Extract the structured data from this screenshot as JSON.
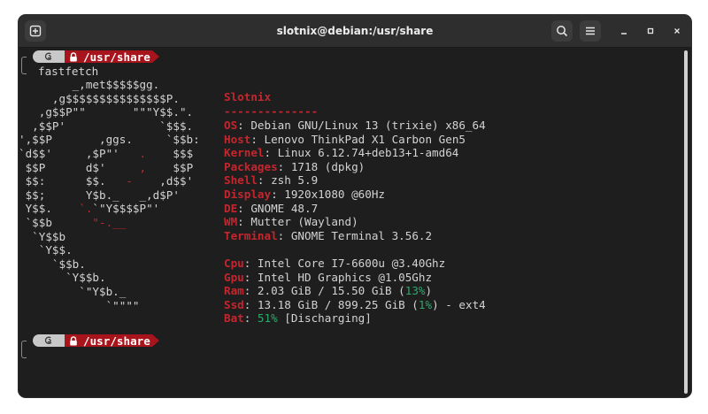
{
  "window": {
    "title": "slotnix@debian:/usr/share"
  },
  "titlebar_icons": {
    "new_tab": "new-tab-icon",
    "search": "search-icon",
    "menu": "hamburger-menu-icon",
    "minimize": "minimize-icon",
    "maximize": "maximize-icon",
    "close": "close-icon"
  },
  "prompt": {
    "os_icon": "debian-swirl-icon",
    "lock_icon": "lock-icon",
    "path": "/usr/share"
  },
  "command": "fastfetch",
  "logo": [
    {
      "seg": [
        {
          "t": "        _,met$$$$$gg.",
          "c": ""
        }
      ]
    },
    {
      "seg": [
        {
          "t": "     ,g$$$$$$$$$$$$$$$P.",
          "c": ""
        }
      ]
    },
    {
      "seg": [
        {
          "t": "   ,g$$P\"\"       \"\"\"Y$$.\".",
          "c": ""
        }
      ]
    },
    {
      "seg": [
        {
          "t": "  ,$$P'              `$$$.",
          "c": ""
        }
      ]
    },
    {
      "seg": [
        {
          "t": "',$$P       ,ggs.     `$$b:",
          "c": ""
        }
      ]
    },
    {
      "seg": [
        {
          "t": "`d$$'     ,$P\"'   ",
          "c": ""
        },
        {
          "t": ".",
          "c": "red"
        },
        {
          "t": "    $$$",
          "c": ""
        }
      ]
    },
    {
      "seg": [
        {
          "t": " $$P      d$'     ",
          "c": ""
        },
        {
          "t": ",",
          "c": "red"
        },
        {
          "t": "    $$P",
          "c": ""
        }
      ]
    },
    {
      "seg": [
        {
          "t": " $$:      $$.   ",
          "c": ""
        },
        {
          "t": "-",
          "c": "red"
        },
        {
          "t": "    ,d$$'",
          "c": ""
        }
      ]
    },
    {
      "seg": [
        {
          "t": " $$;      Y$b._   _,d$P'",
          "c": ""
        }
      ]
    },
    {
      "seg": [
        {
          "t": " Y$$.    ",
          "c": ""
        },
        {
          "t": "`.",
          "c": "red"
        },
        {
          "t": "`\"Y$$$$P\"'",
          "c": ""
        }
      ]
    },
    {
      "seg": [
        {
          "t": " `$$b      ",
          "c": ""
        },
        {
          "t": "\"-.__",
          "c": "red"
        }
      ]
    },
    {
      "seg": [
        {
          "t": "  `Y$$b",
          "c": ""
        }
      ]
    },
    {
      "seg": [
        {
          "t": "   `Y$$.",
          "c": ""
        }
      ]
    },
    {
      "seg": [
        {
          "t": "     `$$b.",
          "c": ""
        }
      ]
    },
    {
      "seg": [
        {
          "t": "       `Y$$b.",
          "c": ""
        }
      ]
    },
    {
      "seg": [
        {
          "t": "         `\"Y$b._",
          "c": ""
        }
      ]
    },
    {
      "seg": [
        {
          "t": "             `\"\"\"\"",
          "c": ""
        }
      ]
    }
  ],
  "info": {
    "user": "Slotnix",
    "separator": "--------------",
    "rows": [
      {
        "key": "OS",
        "value": "Debian GNU/Linux 13 (trixie) x86_64"
      },
      {
        "key": "Host",
        "value": "Lenovo ThinkPad X1 Carbon Gen5"
      },
      {
        "key": "Kernel",
        "value": "Linux 6.12.74+deb13+1-amd64"
      },
      {
        "key": "Packages",
        "value": "1718 (dpkg)"
      },
      {
        "key": "Shell",
        "value": "zsh 5.9"
      },
      {
        "key": "Display",
        "value": "1920x1080 @60Hz"
      },
      {
        "key": "DE",
        "value": "GNOME 48.7"
      },
      {
        "key": "WM",
        "value": "Mutter (Wayland)"
      },
      {
        "key": "Terminal",
        "value": "GNOME Terminal 3.56.2"
      }
    ],
    "hw_rows": [
      {
        "key": "Cpu",
        "value": "Intel Core I7-6600u @3.40Ghz"
      },
      {
        "key": "Gpu",
        "value": "Intel HD Graphics @1.05Ghz"
      },
      {
        "key": "Ram",
        "pre": "2.03 GiB / 15.50 GiB (",
        "pct": "13%",
        "post": ")"
      },
      {
        "key": "Ssd",
        "pre": "13.18 GiB / 899.25 GiB (",
        "pct": "1%",
        "post": ") - ext4"
      },
      {
        "key": "Bat",
        "pre": "",
        "pct": "51%",
        "post": " [Discharging]"
      }
    ]
  },
  "colors": {
    "accent_red": "#c4262e",
    "prompt_path_bg": "#a8141c",
    "percent_green": "#2fa86e",
    "terminal_bg": "#1e1e1e",
    "text": "#d3d3d3"
  }
}
